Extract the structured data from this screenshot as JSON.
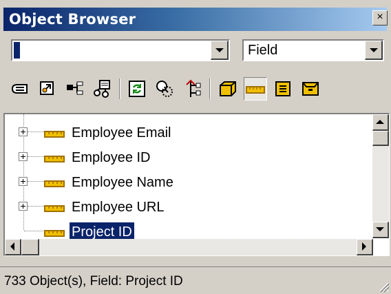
{
  "window": {
    "title": "Object Browser",
    "close_glyph": "×"
  },
  "filters": {
    "scope_value": "",
    "type_value": "Field"
  },
  "toolbar": {
    "buttons": [
      "project-icon",
      "gear-icon",
      "hierarchy-icon",
      "network-icon",
      "refresh-icon",
      "search-icon",
      "tree-arrows-icon",
      "box-icon",
      "field-icon",
      "form-icon",
      "cabinet-icon"
    ],
    "pressed_button": "field-icon"
  },
  "tree": {
    "items": [
      {
        "label": "Employee Email",
        "expandable": true
      },
      {
        "label": "Employee ID",
        "expandable": true
      },
      {
        "label": "Employee Name",
        "expandable": true
      },
      {
        "label": "Employee URL",
        "expandable": true
      },
      {
        "label": "Project ID",
        "expandable": false,
        "selected": true
      }
    ]
  },
  "status": {
    "text": "733 Object(s), Field: Project ID"
  },
  "colors": {
    "selection": "#0a246a",
    "title_start": "#0a246a",
    "title_end": "#a6caf0",
    "field_icon": "#e8a800"
  }
}
